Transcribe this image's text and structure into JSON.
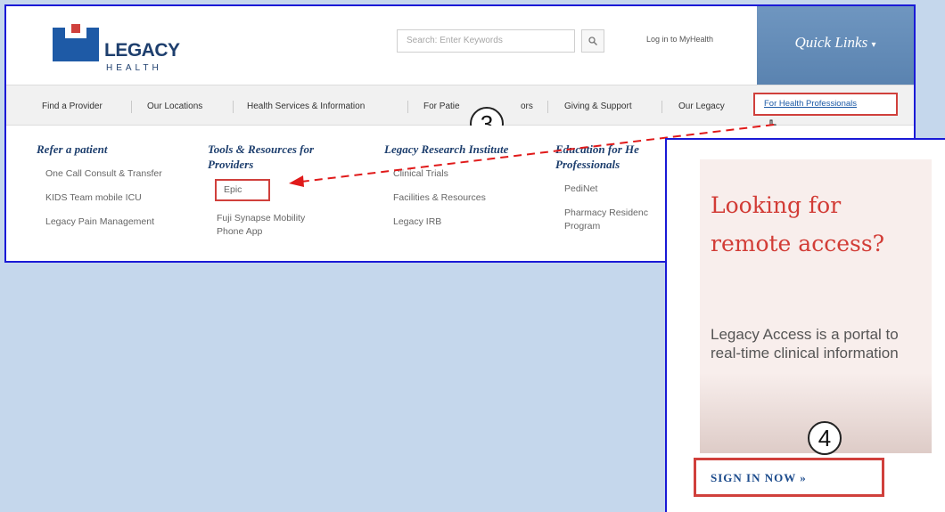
{
  "header": {
    "logo_word1": "LEGACY",
    "logo_word2": "HEALTH",
    "search_placeholder": "Search: Enter Keywords",
    "search_icon": "search-icon",
    "login_link": "Log in to MyHealth",
    "quick_links": "Quick Links",
    "quick_links_caret": "▾"
  },
  "nav": {
    "items": [
      "Find a Provider",
      "Our Locations",
      "Health Services & Information",
      "For Patie",
      "ors",
      "Giving & Support",
      "Our Legacy"
    ],
    "active_item": "For Health Professionals"
  },
  "menu": {
    "columns": [
      {
        "title": "Refer a patient",
        "links": [
          "One Call Consult & Transfer",
          "KIDS Team mobile ICU",
          "Legacy Pain Management"
        ]
      },
      {
        "title": "Tools & Resources for Providers",
        "links": [
          "Epic",
          "Fuji Synapse Mobility Phone App"
        ]
      },
      {
        "title": "Legacy Research Institute",
        "links": [
          "Clinical Trials",
          "Facilities & Resources",
          "Legacy IRB"
        ]
      },
      {
        "title": "Education for He Professionals",
        "links": [
          "PediNet",
          "Pharmacy Residenc Program"
        ]
      }
    ]
  },
  "callouts": {
    "step3": "3",
    "step4": "4"
  },
  "promo": {
    "heading": "Looking for remote access?",
    "body": "Legacy Access is a portal to real-time clinical information",
    "cta": "SIGN IN NOW »"
  },
  "colors": {
    "background": "#c5d7ec",
    "highlight_border": "#d0403c",
    "frame_border": "#1a1ad6",
    "brand_blue": "#1e3f6e",
    "promo_red": "#d23c36"
  }
}
